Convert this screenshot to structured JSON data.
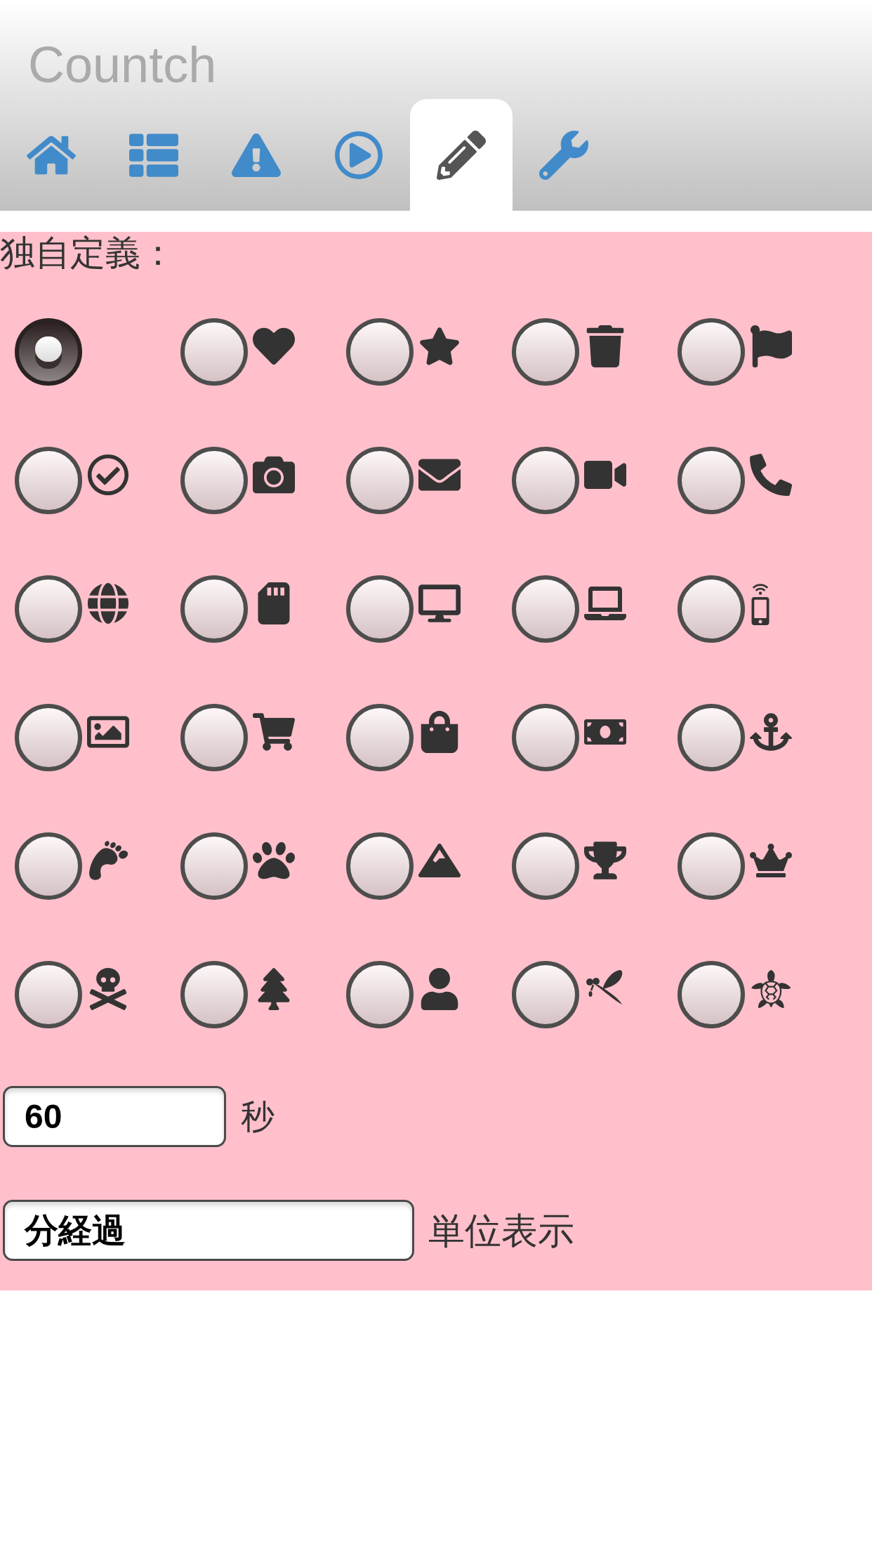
{
  "header": {
    "title": "Countch"
  },
  "tabs": [
    {
      "selected": false
    },
    {
      "selected": false
    },
    {
      "selected": false
    },
    {
      "selected": false
    },
    {
      "selected": true
    },
    {
      "selected": false
    }
  ],
  "custom": {
    "label": "独自定義：",
    "options": [
      {
        "selected": true
      },
      {
        "selected": false
      },
      {
        "selected": false
      },
      {
        "selected": false
      },
      {
        "selected": false
      },
      {
        "selected": false
      },
      {
        "selected": false
      },
      {
        "selected": false
      },
      {
        "selected": false
      },
      {
        "selected": false
      },
      {
        "selected": false
      },
      {
        "selected": false
      },
      {
        "selected": false
      },
      {
        "selected": false
      },
      {
        "selected": false
      },
      {
        "selected": false
      },
      {
        "selected": false
      },
      {
        "selected": false
      },
      {
        "selected": false
      },
      {
        "selected": false
      },
      {
        "selected": false
      },
      {
        "selected": false
      },
      {
        "selected": false
      },
      {
        "selected": false
      },
      {
        "selected": false
      },
      {
        "selected": false
      },
      {
        "selected": false
      },
      {
        "selected": false
      },
      {
        "selected": false
      },
      {
        "selected": false
      }
    ]
  },
  "interval_field": {
    "value": "60",
    "unit": "秒"
  },
  "display_field": {
    "value": "分経過",
    "unit": "単位表示"
  }
}
